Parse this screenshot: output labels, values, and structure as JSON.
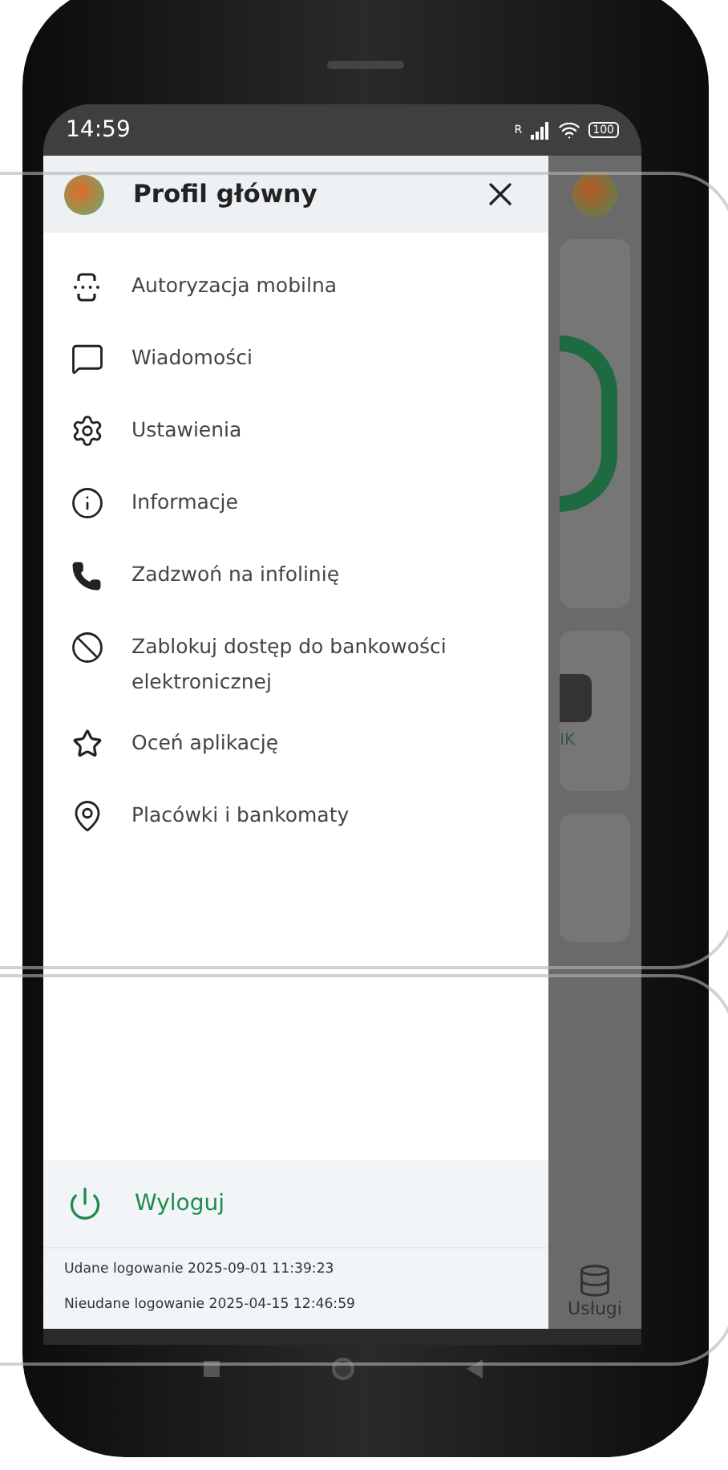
{
  "status_bar": {
    "time": "14:59",
    "signal_label": "R",
    "battery": "100"
  },
  "drawer": {
    "title": "Profil główny",
    "items": [
      {
        "label": "Autoryzacja mobilna"
      },
      {
        "label": "Wiadomości"
      },
      {
        "label": "Ustawienia"
      },
      {
        "label": "Informacje"
      },
      {
        "label": "Zadzwoń na infolinię"
      },
      {
        "label": "Zablokuj dostęp do bankowości elektronicznej"
      },
      {
        "label": "Oceń aplikację"
      },
      {
        "label": "Placówki i bankomaty"
      }
    ],
    "logout": "Wyloguj",
    "login_info": [
      "Udane logowanie 2025-09-01 11:39:23",
      "Nieudane logowanie 2025-04-15 12:46:59"
    ]
  },
  "background": {
    "tile_label": "IK",
    "nav_label": "Usługi"
  }
}
